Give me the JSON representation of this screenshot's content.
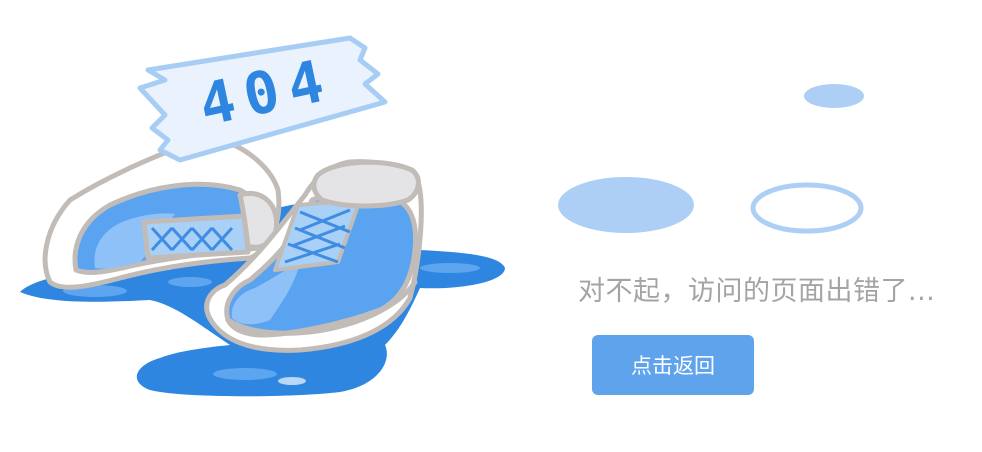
{
  "error": {
    "code_text": "404",
    "message": "对不起，访问的页面出错了...",
    "back_button_label": "点击返回"
  },
  "colors": {
    "primary": "#5fa3ec",
    "puddle": "#2f86e0",
    "light_blue": "#aecff5",
    "text_gray": "#a4a4a4"
  },
  "icons": {
    "illustration": "sneakers-in-puddle-illustration",
    "decor": "bubble-decoration"
  }
}
